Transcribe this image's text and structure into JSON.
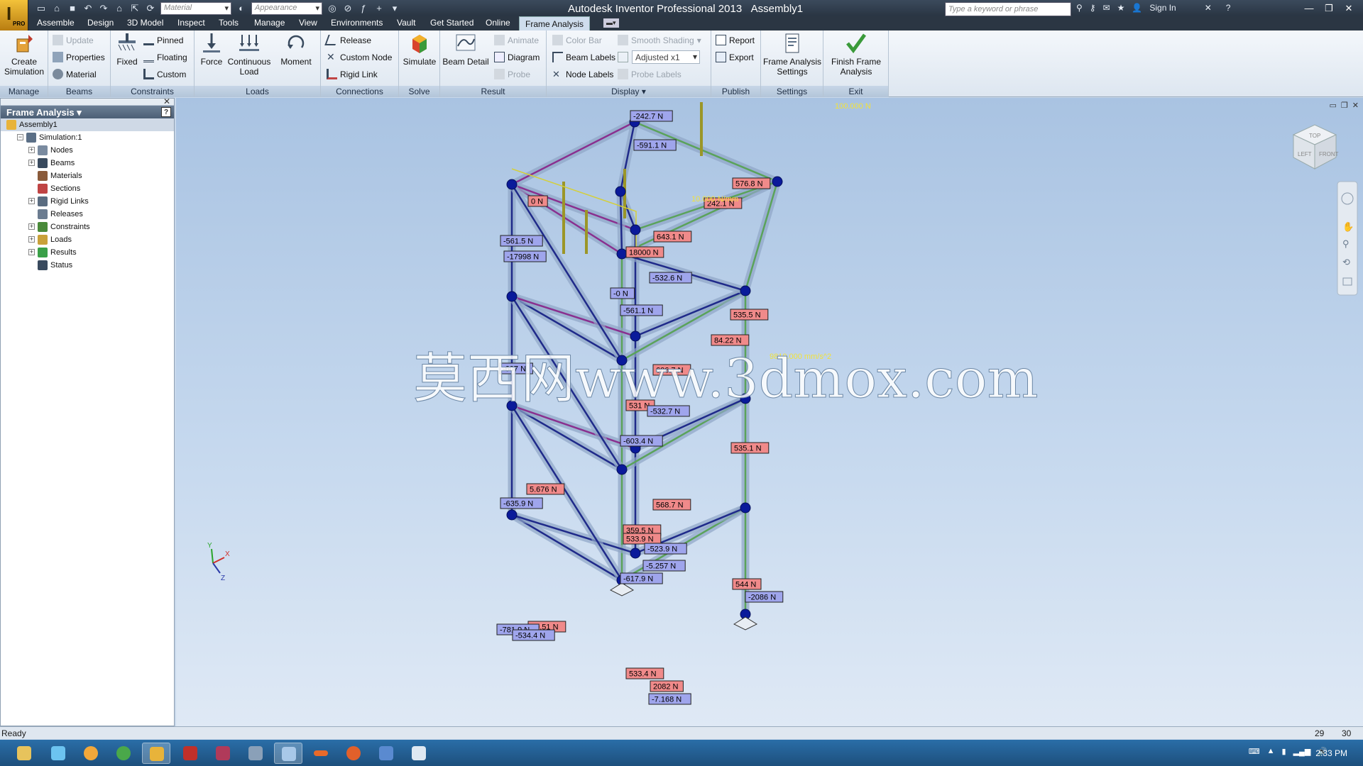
{
  "window": {
    "title": "Autodesk Inventor Professional 2013",
    "document": "Assembly1",
    "logo_badge": "PRO",
    "material_combo": "Material",
    "appearance_combo": "Appearance",
    "search_placeholder": "Type a keyword or phrase",
    "sign_in": "Sign In"
  },
  "menu_tabs": [
    "Assemble",
    "Design",
    "3D Model",
    "Inspect",
    "Tools",
    "Manage",
    "View",
    "Environments",
    "Vault",
    "Get Started",
    "Online",
    "Frame Analysis"
  ],
  "ribbon": {
    "manage": {
      "title": "Manage",
      "create_simulation": "Create Simulation"
    },
    "beams": {
      "title": "Beams",
      "update": "Update",
      "properties": "Properties",
      "material": "Material"
    },
    "constraints": {
      "title": "Constraints",
      "fixed": "Fixed",
      "pinned": "Pinned",
      "floating": "Floating",
      "custom": "Custom"
    },
    "loads": {
      "title": "Loads",
      "force": "Force",
      "continuous_load": "Continuous Load",
      "moment": "Moment"
    },
    "connections": {
      "title": "Connections",
      "release": "Release",
      "custom_node": "Custom Node",
      "rigid_link": "Rigid Link"
    },
    "solve": {
      "title": "Solve",
      "simulate": "Simulate"
    },
    "result": {
      "title": "Result",
      "beam_detail": "Beam Detail",
      "animate": "Animate",
      "diagram": "Diagram",
      "probe": "Probe"
    },
    "display": {
      "title": "Display",
      "color_bar": "Color Bar",
      "beam_labels": "Beam Labels",
      "node_labels": "Node Labels",
      "smooth_shading": "Smooth Shading",
      "adjusted": "Adjusted x1",
      "probe_labels": "Probe Labels"
    },
    "publish": {
      "title": "Publish",
      "report": "Report",
      "export": "Export"
    },
    "settings": {
      "title": "Settings",
      "frame_analysis_settings": "Frame Analysis Settings"
    },
    "exit": {
      "title": "Exit",
      "finish_frame_analysis": "Finish Frame Analysis"
    }
  },
  "browser": {
    "title": "Frame Analysis",
    "items": [
      {
        "label": "Assembly1",
        "level": 0,
        "expander": ""
      },
      {
        "label": "Simulation:1",
        "level": 1,
        "expander": "−"
      },
      {
        "label": "Nodes",
        "level": 2,
        "expander": "+"
      },
      {
        "label": "Beams",
        "level": 2,
        "expander": "+"
      },
      {
        "label": "Materials",
        "level": 2,
        "expander": ""
      },
      {
        "label": "Sections",
        "level": 2,
        "expander": ""
      },
      {
        "label": "Rigid Links",
        "level": 2,
        "expander": "+"
      },
      {
        "label": "Releases",
        "level": 2,
        "expander": ""
      },
      {
        "label": "Constraints",
        "level": 2,
        "expander": "+"
      },
      {
        "label": "Loads",
        "level": 2,
        "expander": "+"
      },
      {
        "label": "Results",
        "level": 2,
        "expander": "+"
      },
      {
        "label": "Status",
        "level": 2,
        "expander": ""
      }
    ]
  },
  "viewport": {
    "load_labels": [
      "100.000 N",
      "10.000 N/mm",
      "9810.000 mm/s^2"
    ],
    "watermark": "莫西网www.3dmox.com",
    "triad": {
      "x": "X",
      "y": "Y",
      "z": "Z"
    },
    "viewcube": {
      "top": "TOP",
      "left": "LEFT",
      "front": "FRONT"
    },
    "result_labels": [
      {
        "t": "-242.7 N",
        "c": "b"
      },
      {
        "t": "-591.1 N",
        "c": "b"
      },
      {
        "t": "576.8 N",
        "c": "r"
      },
      {
        "t": "242.1 N",
        "c": "r"
      },
      {
        "t": "0 N",
        "c": "r"
      },
      {
        "t": "-561.5 N",
        "c": "b"
      },
      {
        "t": "-17998 N",
        "c": "b"
      },
      {
        "t": "643.1 N",
        "c": "r"
      },
      {
        "t": "18000 N",
        "c": "r"
      },
      {
        "t": "-532.6 N",
        "c": "b"
      },
      {
        "t": "-0 N",
        "c": "b"
      },
      {
        "t": "-561.1 N",
        "c": "b"
      },
      {
        "t": "535.5 N",
        "c": "r"
      },
      {
        "t": "84.22 N",
        "c": "r"
      },
      {
        "t": "-607 N",
        "c": "b"
      },
      {
        "t": "606.7 N",
        "c": "r"
      },
      {
        "t": "531 N",
        "c": "r"
      },
      {
        "t": "-532.7 N",
        "c": "b"
      },
      {
        "t": "-603.4 N",
        "c": "b"
      },
      {
        "t": "535.1 N",
        "c": "r"
      },
      {
        "t": "5.676 N",
        "c": "r"
      },
      {
        "t": "-635.9 N",
        "c": "b"
      },
      {
        "t": "568.7 N",
        "c": "r"
      },
      {
        "t": "359.5 N",
        "c": "r"
      },
      {
        "t": "533.9 N",
        "c": "r"
      },
      {
        "t": "-523.9 N",
        "c": "b"
      },
      {
        "t": "-5.257 N",
        "c": "b"
      },
      {
        "t": "-617.9 N",
        "c": "b"
      },
      {
        "t": "544 N",
        "c": "r"
      },
      {
        "t": "-2086 N",
        "c": "b"
      },
      {
        "t": "10.51 N",
        "c": "r"
      },
      {
        "t": "-781.9 N",
        "c": "b"
      },
      {
        "t": "-534.4 N",
        "c": "b"
      },
      {
        "t": "533.4 N",
        "c": "r"
      },
      {
        "t": "2082 N",
        "c": "r"
      },
      {
        "t": "-7.168 N",
        "c": "b"
      }
    ]
  },
  "status": {
    "text": "Ready",
    "n1": "29",
    "n2": "30"
  },
  "taskbar": {
    "clock": "2:33 PM"
  },
  "colors": {
    "label_blue": "#9fa5ec",
    "label_red": "#f08a8a",
    "ribbon_active_tab": "#cfdded",
    "viewport_top": "#a9c3e2"
  }
}
